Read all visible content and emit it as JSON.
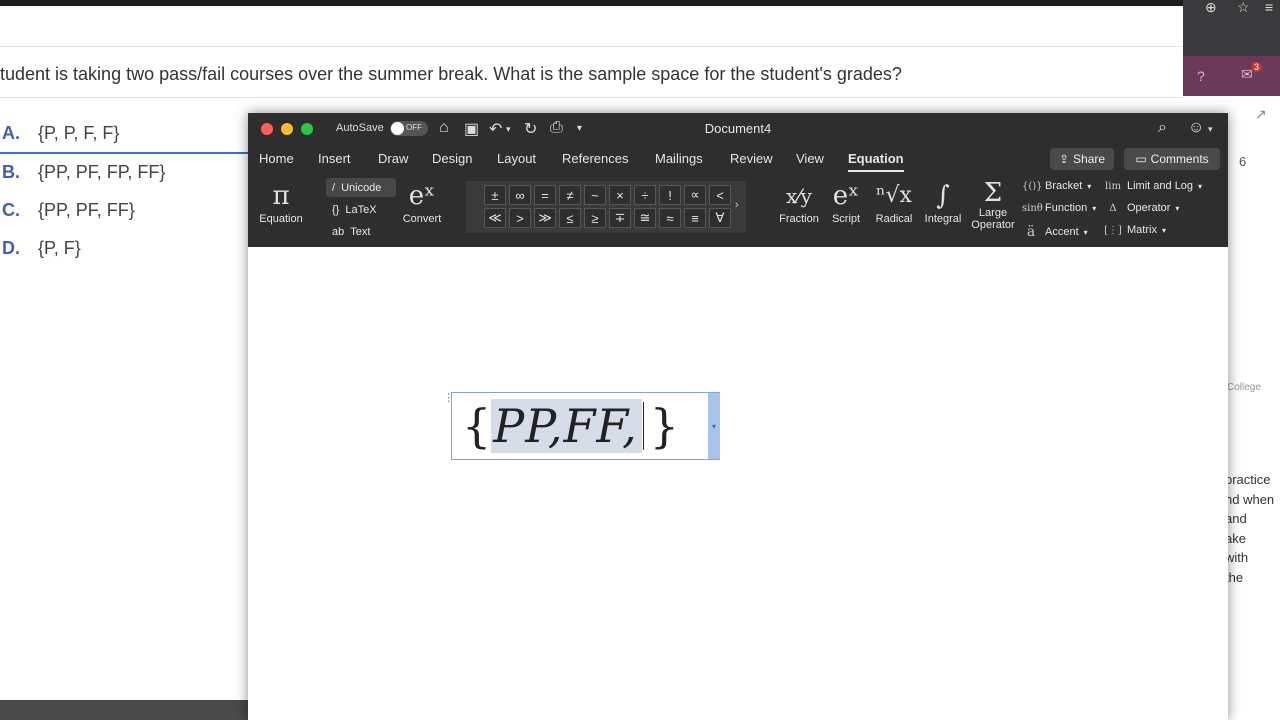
{
  "background_page": {
    "question": "tudent is taking two pass/fail courses over the summer break. What is the sample space for the student's grades?",
    "choices": [
      {
        "letter": "A.",
        "text": "{P, P, F, F}"
      },
      {
        "letter": "B.",
        "text": "{PP, PF, FP, FF}"
      },
      {
        "letter": "C.",
        "text": "{PP, PF, FF}"
      },
      {
        "letter": "D.",
        "text": "{P, F}"
      }
    ]
  },
  "right_chrome": {
    "tab_count": "6",
    "badge": "3",
    "college_label": "College",
    "text_lines": [
      "practice",
      "nd when",
      "and",
      "ake",
      "with",
      "the"
    ]
  },
  "word": {
    "autosave_label": "AutoSave",
    "autosave_state": "OFF",
    "document_title": "Document4",
    "tabs": [
      "Home",
      "Insert",
      "Draw",
      "Design",
      "Layout",
      "References",
      "Mailings",
      "Review",
      "View",
      "Equation"
    ],
    "active_tab": "Equation",
    "share_label": "Share",
    "comments_label": "Comments",
    "ribbon": {
      "equation_label": "Equation",
      "equation_glyph": "π",
      "modes": [
        {
          "icon": "/",
          "label": "Unicode"
        },
        {
          "icon": "{}",
          "label": "LaTeX"
        },
        {
          "icon": "ab",
          "label": "Text"
        }
      ],
      "convert_label": "Convert",
      "convert_glyph": "eˣ",
      "symbols_row1": [
        "±",
        "∞",
        "=",
        "≠",
        "~",
        "×",
        "÷",
        "!",
        "∝",
        "<"
      ],
      "symbols_row2": [
        "≪",
        ">",
        "≫",
        "≤",
        "≥",
        "∓",
        "≅",
        "≈",
        "≡",
        "∀"
      ],
      "structures": [
        {
          "label": "Fraction",
          "glyph": "x⁄y"
        },
        {
          "label": "Script",
          "glyph": "eˣ"
        },
        {
          "label": "Radical",
          "glyph": "ⁿ√x"
        },
        {
          "label": "Integral",
          "glyph": "∫"
        },
        {
          "label": "Large Operator",
          "glyph": "Σ"
        }
      ],
      "side_items": [
        {
          "label": "Bracket",
          "glyph": "{()}"
        },
        {
          "label": "Function",
          "glyph": "sinθ"
        },
        {
          "label": "Accent",
          "glyph": "ä"
        },
        {
          "label": "Limit and Log",
          "glyph": "lim"
        },
        {
          "label": "Operator",
          "glyph": "Δ"
        },
        {
          "label": "Matrix",
          "glyph": "[⋮]"
        }
      ]
    },
    "equation": {
      "open": "{",
      "selected": "PP,FF,",
      "close": "}"
    }
  }
}
